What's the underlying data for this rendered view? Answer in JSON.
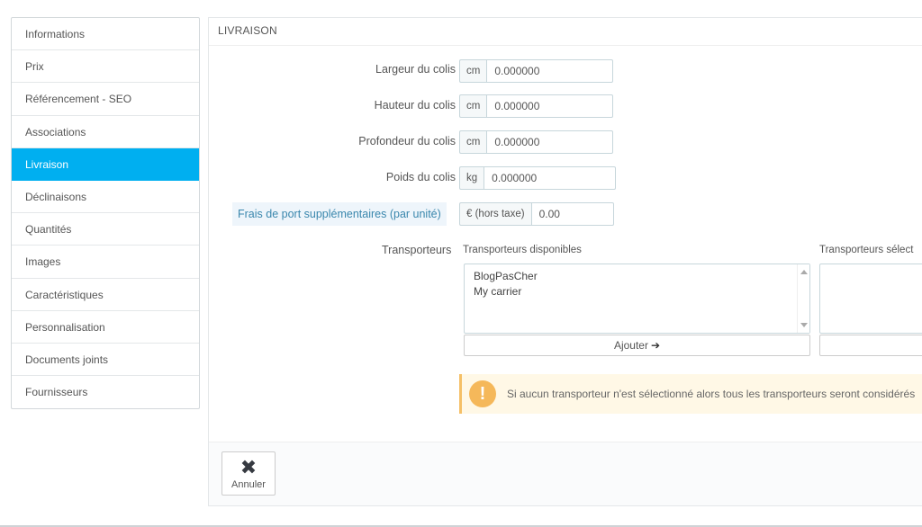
{
  "sidebar": {
    "items": [
      {
        "label": "Informations"
      },
      {
        "label": "Prix"
      },
      {
        "label": "Référencement - SEO"
      },
      {
        "label": "Associations"
      },
      {
        "label": "Livraison",
        "active": true
      },
      {
        "label": "Déclinaisons"
      },
      {
        "label": "Quantités"
      },
      {
        "label": "Images"
      },
      {
        "label": "Caractéristiques"
      },
      {
        "label": "Personnalisation"
      },
      {
        "label": "Documents joints"
      },
      {
        "label": "Fournisseurs"
      }
    ]
  },
  "panel": {
    "title": "LIVRAISON",
    "fields": {
      "width": {
        "label": "Largeur du colis",
        "unit": "cm",
        "value": "0.000000"
      },
      "height": {
        "label": "Hauteur du colis",
        "unit": "cm",
        "value": "0.000000"
      },
      "depth": {
        "label": "Profondeur du colis",
        "unit": "cm",
        "value": "0.000000"
      },
      "weight": {
        "label": "Poids du colis",
        "unit": "kg",
        "value": "0.000000"
      },
      "extra_fees": {
        "label": "Frais de port supplémentaires (par unité)",
        "unit": "€ (hors taxe)",
        "value": "0.00"
      }
    },
    "carriers": {
      "label": "Transporteurs",
      "available_label": "Transporteurs disponibles",
      "selected_label": "Transporteurs sélect",
      "available": [
        "BlogPasCher",
        "My carrier"
      ],
      "add_label": "Ajouter",
      "add_arrow": "➔"
    },
    "alert": {
      "icon": "!",
      "text": "Si aucun transporteur n'est sélectionné alors tous les transporteurs seront considérés"
    },
    "footer": {
      "cancel_icon": "✖",
      "cancel_label": "Annuler"
    }
  },
  "colors": {
    "accent": "#00aff0",
    "alert_bg": "#fff8e6",
    "alert_icon": "#f5b85a",
    "highlight_label": "#3a87ad"
  }
}
